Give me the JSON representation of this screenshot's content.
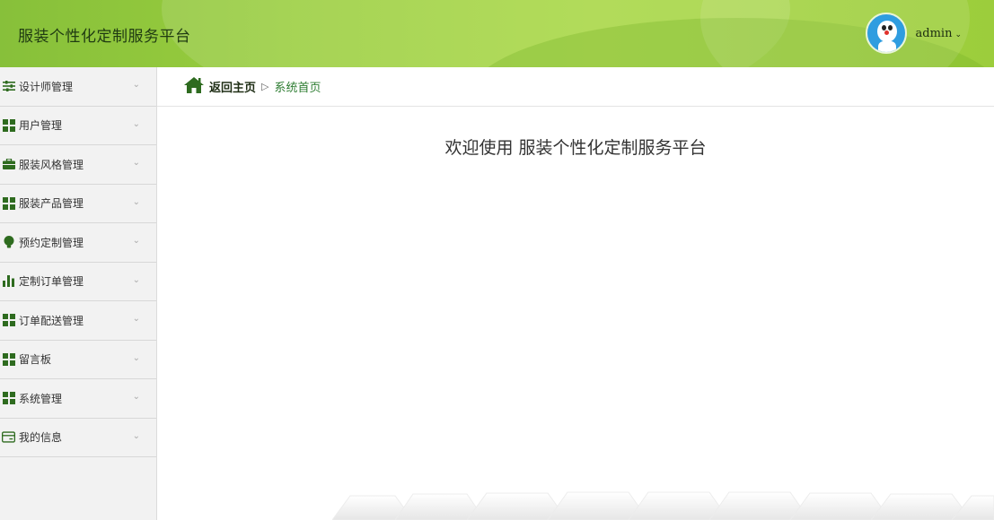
{
  "header": {
    "brand": "服装个性化定制服务平台",
    "username": "admin",
    "caret": "⌄"
  },
  "sidebar": {
    "items": [
      {
        "label": "设计师管理",
        "icon": "sliders-icon"
      },
      {
        "label": "用户管理",
        "icon": "grid-icon"
      },
      {
        "label": "服装风格管理",
        "icon": "briefcase-icon"
      },
      {
        "label": "服装产品管理",
        "icon": "grid-icon"
      },
      {
        "label": "预约定制管理",
        "icon": "lightbulb-icon"
      },
      {
        "label": "定制订单管理",
        "icon": "bar-chart-icon"
      },
      {
        "label": "订单配送管理",
        "icon": "grid-icon"
      },
      {
        "label": "留言板",
        "icon": "grid-icon"
      },
      {
        "label": "系统管理",
        "icon": "grid-icon"
      },
      {
        "label": "我的信息",
        "icon": "card-icon"
      }
    ],
    "chevron": "⌄"
  },
  "breadcrumb": {
    "home": "返回主页",
    "separator": "▷",
    "current": "系统首页"
  },
  "main": {
    "welcome": "欢迎使用 服装个性化定制服务平台"
  },
  "colors": {
    "header_green": "#9dd03f",
    "icon_green": "#2e6b1f",
    "link_green": "#2e7d32",
    "sidebar_bg": "#f2f2f2"
  }
}
